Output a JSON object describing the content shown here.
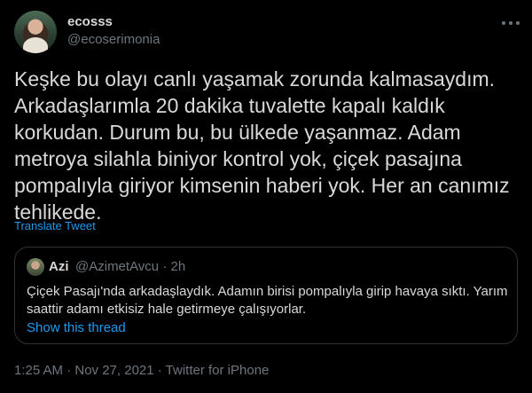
{
  "author": {
    "name": "ecosss",
    "handle": "@ecoserimonia"
  },
  "tweet": {
    "text": "Keşke bu olayı canlı yaşamak zorunda kalmasaydım. Arkadaşlarımla 20 dakika tuvalette kapalı kaldık korkudan. Durum bu, bu ülkede yaşanmaz. Adam metroya silahla biniyor kontrol yok, çiçek pasajına pompalıyla giriyor kimsenin haberi yok. Her an canımız tehlikede.",
    "translate_label": "Translate Tweet"
  },
  "quoted": {
    "name": "Azi",
    "handle_time": "@AzimetAvcu · 2h",
    "text": "Çiçek Pasajı'nda arkadaşlaydık. Adamın birisi pompalıyla girip havaya sıktı. Yarım saattir adamı etkisiz hale getirmeye çalışıyorlar.",
    "show_thread": "Show this thread"
  },
  "meta": "1:25 AM · Nov 27, 2021 · Twitter for iPhone",
  "icons": [
    "more-icon"
  ],
  "colors": {
    "background": "#000000",
    "text": "#d9d9d9",
    "secondary": "#6e767d",
    "link": "#1d9bf0",
    "border": "#2f3336"
  }
}
